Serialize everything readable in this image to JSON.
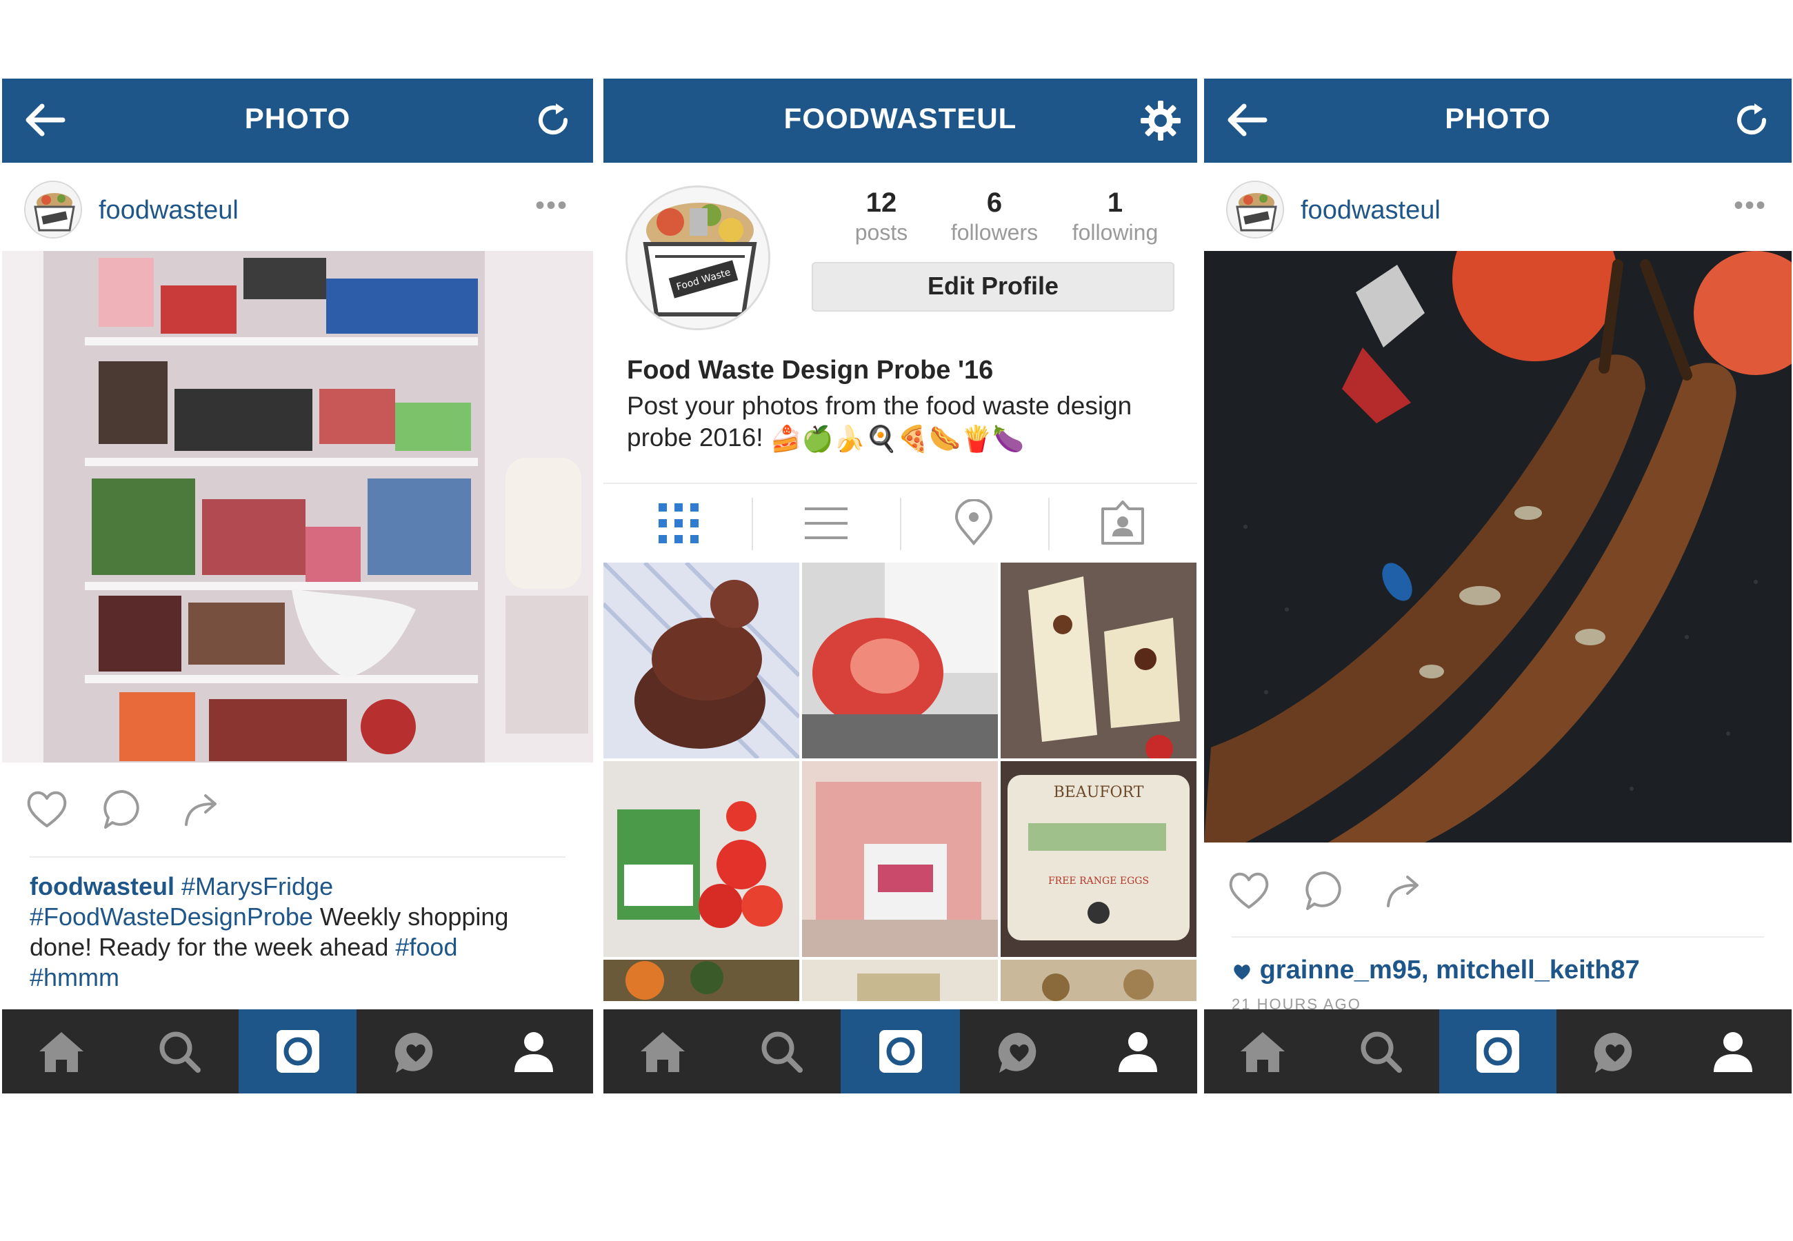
{
  "screens": {
    "left": {
      "topbar": {
        "title": "PHOTO",
        "back_icon": "arrow-left-icon",
        "refresh_icon": "refresh-icon"
      },
      "post": {
        "username": "foodwasteul",
        "more": "•••",
        "photo_subject": "open fridge with shelves of groceries",
        "caption": {
          "user": "foodwasteul",
          "tag1": "#MarysFridge",
          "tag2": "#FoodWasteDesignProbe",
          "text": "Weekly shopping done! Ready for the week ahead",
          "tag3": "#food",
          "tag4": "#hmmm"
        }
      }
    },
    "middle": {
      "topbar": {
        "title": "FOODWASTEUL",
        "settings_icon": "gear-icon"
      },
      "profile": {
        "stats": [
          {
            "value": "12",
            "label": "posts"
          },
          {
            "value": "6",
            "label": "followers"
          },
          {
            "value": "1",
            "label": "following"
          }
        ],
        "edit_button": "Edit Profile",
        "name": "Food Waste Design Probe '16",
        "bio_line1": "Post your photos from the food waste design",
        "bio_line2": "probe 2016!",
        "emojis": "🍰🍏🍌🍳🍕🌭🍟🍆"
      },
      "view_tabs": [
        "grid-view-icon",
        "list-view-icon",
        "location-pin-icon",
        "tagged-photos-icon"
      ]
    },
    "right": {
      "topbar": {
        "title": "PHOTO",
        "back_icon": "arrow-left-icon",
        "refresh_icon": "refresh-icon"
      },
      "post": {
        "username": "foodwasteul",
        "more": "•••",
        "photo_subject": "overripe brown bananas on dark counter",
        "likes": "grainne_m95, mitchell_keith87",
        "time": "21 HOURS AGO"
      }
    }
  },
  "tabbar": [
    "home-icon",
    "search-icon",
    "camera-icon",
    "activity-heart-icon",
    "profile-icon"
  ],
  "colors": {
    "brand": "#1f5689",
    "tabbar": "#2a2a2a",
    "text": "#262626",
    "muted": "#9a9a9a"
  }
}
